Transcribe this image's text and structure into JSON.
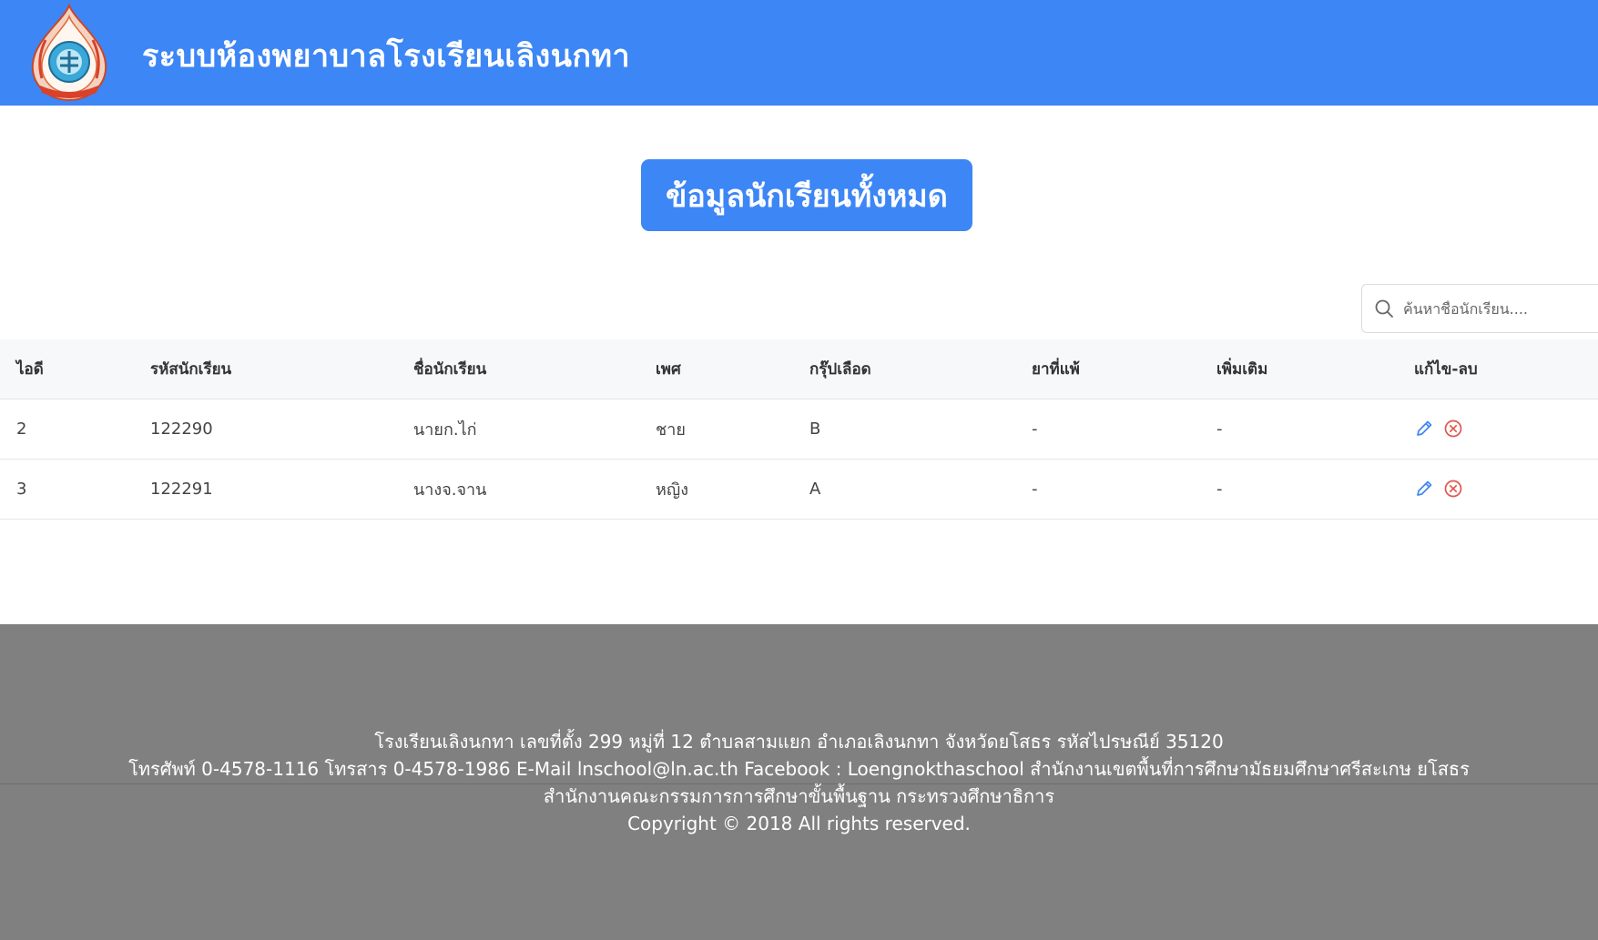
{
  "header": {
    "title": "ระบบห้องพยาบาลโรงเรียนเลิงนกทา",
    "logo_icon": "school-emblem-icon"
  },
  "main": {
    "section_title": "ข้อมูลนักเรียนทั้งหมด"
  },
  "search": {
    "placeholder": "ค้นหาชื่อนักเรียน....",
    "value": ""
  },
  "table": {
    "headers": {
      "id": "ไอดี",
      "student_code": "รหัสนักเรียน",
      "student_name": "ชื่อนักเรียน",
      "sex": "เพศ",
      "blood_group": "กรุ๊ปเลือด",
      "allergy": "ยาที่แพ้",
      "extra": "เพิ่มเติม",
      "actions": "แก้ไข-ลบ"
    },
    "rows": [
      {
        "id": "2",
        "student_code": "122290",
        "student_name": "นายก.ไก่",
        "sex": "ชาย",
        "blood_group": "B",
        "allergy": "-",
        "extra": "-"
      },
      {
        "id": "3",
        "student_code": "122291",
        "student_name": "นางจ.จาน",
        "sex": "หญิง",
        "blood_group": "A",
        "allergy": "-",
        "extra": "-"
      }
    ]
  },
  "footer": {
    "line1": "โรงเรียนเลิงนกทา เลขที่ตั้ง 299 หมู่ที่ 12 ตำบลสามแยก อำเภอเลิงนกทา จังหวัดยโสธร รหัสไปรษณีย์ 35120",
    "line2": "โทรศัพท์ 0-4578-1116 โทรสาร 0-4578-1986 E-Mail lnschool@ln.ac.th Facebook : Loengnokthaschool สำนักงานเขตพื้นที่การศึกษามัธยมศึกษาศรีสะเกษ ยโสธร",
    "line3": "สำนักงานคณะกรรมการการศึกษาขั้นพื้นฐาน กระทรวงศึกษาธิการ",
    "line4": "Copyright © 2018 All rights reserved."
  },
  "colors": {
    "primary": "#3d86f5",
    "footer_bg": "#808080",
    "edit_icon": "#3d86f5",
    "delete_icon": "#e0574f"
  }
}
